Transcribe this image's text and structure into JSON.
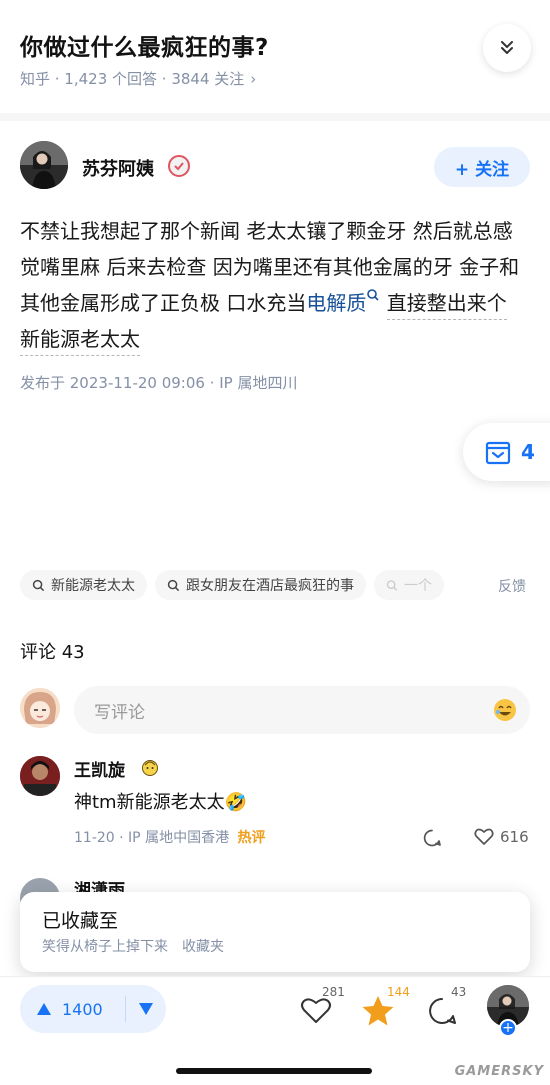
{
  "question": {
    "title": "你做过什么最疯狂的事?",
    "meta": "知乎 · 1,423 个回答 · 3844 关注",
    "meta_chevron": "›"
  },
  "author": {
    "name": "苏芬阿姨",
    "follow_label": "+ 关注"
  },
  "answer": {
    "text_before_link": "不禁让我想起了那个新闻 老太太镶了颗金牙 然后就总感觉嘴里麻 后来去检查 因为嘴里还有其他金属的牙 金子和其他金属形成了正负极 口水充当",
    "link_text": "电解质",
    "text_after_link": "直接整出来个新能源老太太",
    "publish_info": "发布于 2023-11-20 09:06 · IP 属地四川"
  },
  "collect_float": {
    "count": "4"
  },
  "tags": [
    {
      "label": "新能源老太太"
    },
    {
      "label": "跟女朋友在酒店最疯狂的事"
    },
    {
      "label": "一个"
    }
  ],
  "feedback_label": "反馈",
  "comments": {
    "title": "评论 43",
    "input_placeholder": "写评论",
    "items": [
      {
        "author": "王凯旋",
        "text": "神tm新能源老太太🤣",
        "date": "11-20",
        "ip": "IP 属地中国香港",
        "hot_label": "热评",
        "likes": "616"
      },
      {
        "author": "湘潇雨"
      }
    ]
  },
  "toast": {
    "title": "已收藏至",
    "subtitle": "笑得从椅子上掉下来　收藏夹"
  },
  "bottom_bar": {
    "upvote_count": "1400",
    "like_count": "281",
    "favorite_count": "144",
    "comment_count": "43"
  },
  "watermark": "GAMERSKY",
  "colors": {
    "accent": "#1772f6",
    "accent_bg": "#e8f1fd",
    "favorite": "#f09e1b",
    "meta_gray": "#8590a6"
  }
}
